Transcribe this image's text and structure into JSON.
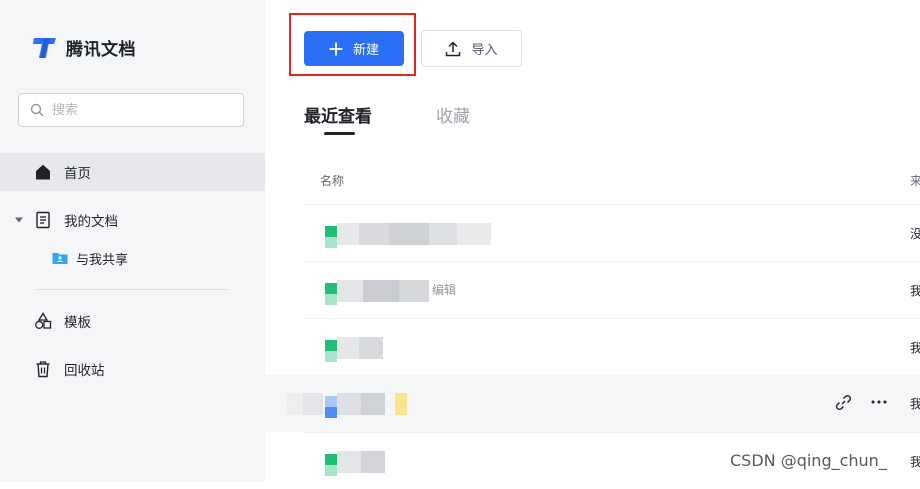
{
  "app": {
    "name": "腾讯文档"
  },
  "search": {
    "placeholder": "搜索"
  },
  "sidebar": {
    "items": [
      {
        "label": "首页",
        "icon": "home-icon"
      },
      {
        "label": "我的文档",
        "icon": "document-icon"
      },
      {
        "label": "与我共享",
        "icon": "shared-folder-icon"
      },
      {
        "label": "模板",
        "icon": "template-icon"
      },
      {
        "label": "回收站",
        "icon": "trash-icon"
      }
    ]
  },
  "toolbar": {
    "new_label": "新建",
    "import_label": "导入"
  },
  "tabs": [
    {
      "label": "最近查看"
    },
    {
      "label": "收藏"
    }
  ],
  "table": {
    "columns": {
      "name": "名称",
      "source": "来"
    },
    "rows": [
      {
        "source": "没",
        "title_tail": ""
      },
      {
        "source": "我",
        "title_tail": "编辑"
      },
      {
        "source": "我",
        "title_tail": ""
      },
      {
        "source": "我",
        "title_tail": ""
      },
      {
        "source": "我",
        "title_tail": ""
      }
    ]
  },
  "watermark": "CSDN @qing_chun_",
  "colors": {
    "accent": "#2b6ff5",
    "highlight": "#e8241a",
    "sidebar_bg": "#f5f6f7",
    "doc_green": "#1fbf75",
    "doc_blue": "#4e8df5",
    "folder_blue": "#2fa7f5"
  }
}
